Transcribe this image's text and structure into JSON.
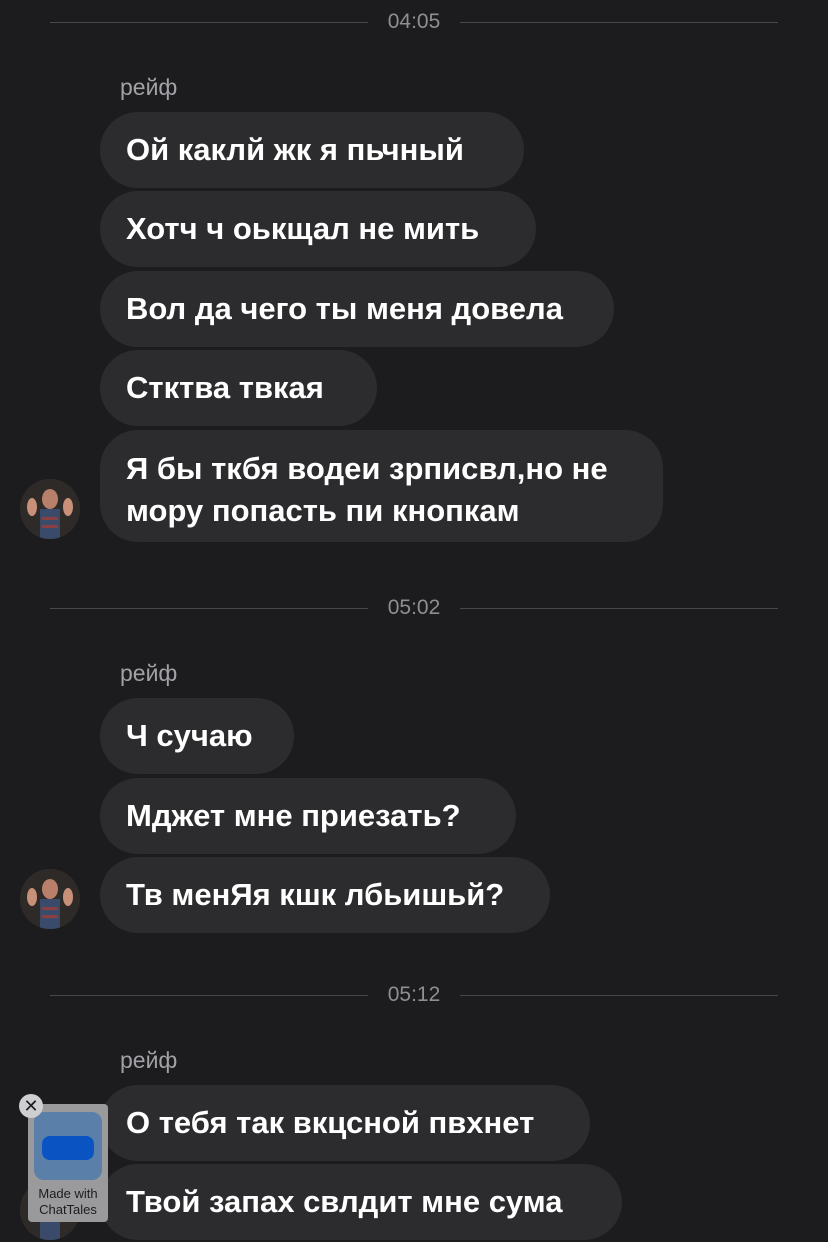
{
  "groups": [
    {
      "time": "04:05",
      "sender": "рейф",
      "messages": [
        "Ой каклй жк я пьчный",
        "Хотч ч оькщал не мить",
        "Вол да чего ты меня довела",
        "Стктва твкая",
        "Я бы ткбя водеи зрписвл,но не мору попасть пи кнопкам"
      ]
    },
    {
      "time": "05:02",
      "sender": "рейф",
      "messages": [
        "Ч сучаю",
        "Мджет мне приезать?",
        "Тв менЯя кшк лбьишьй?"
      ]
    },
    {
      "time": "05:12",
      "sender": "рейф",
      "messages": [
        "О тебя так вкцсной пвхнет",
        "Твой запах свлдит мне сума"
      ]
    }
  ],
  "watermark": {
    "close": "✕",
    "label": "Made with ChatTales"
  }
}
